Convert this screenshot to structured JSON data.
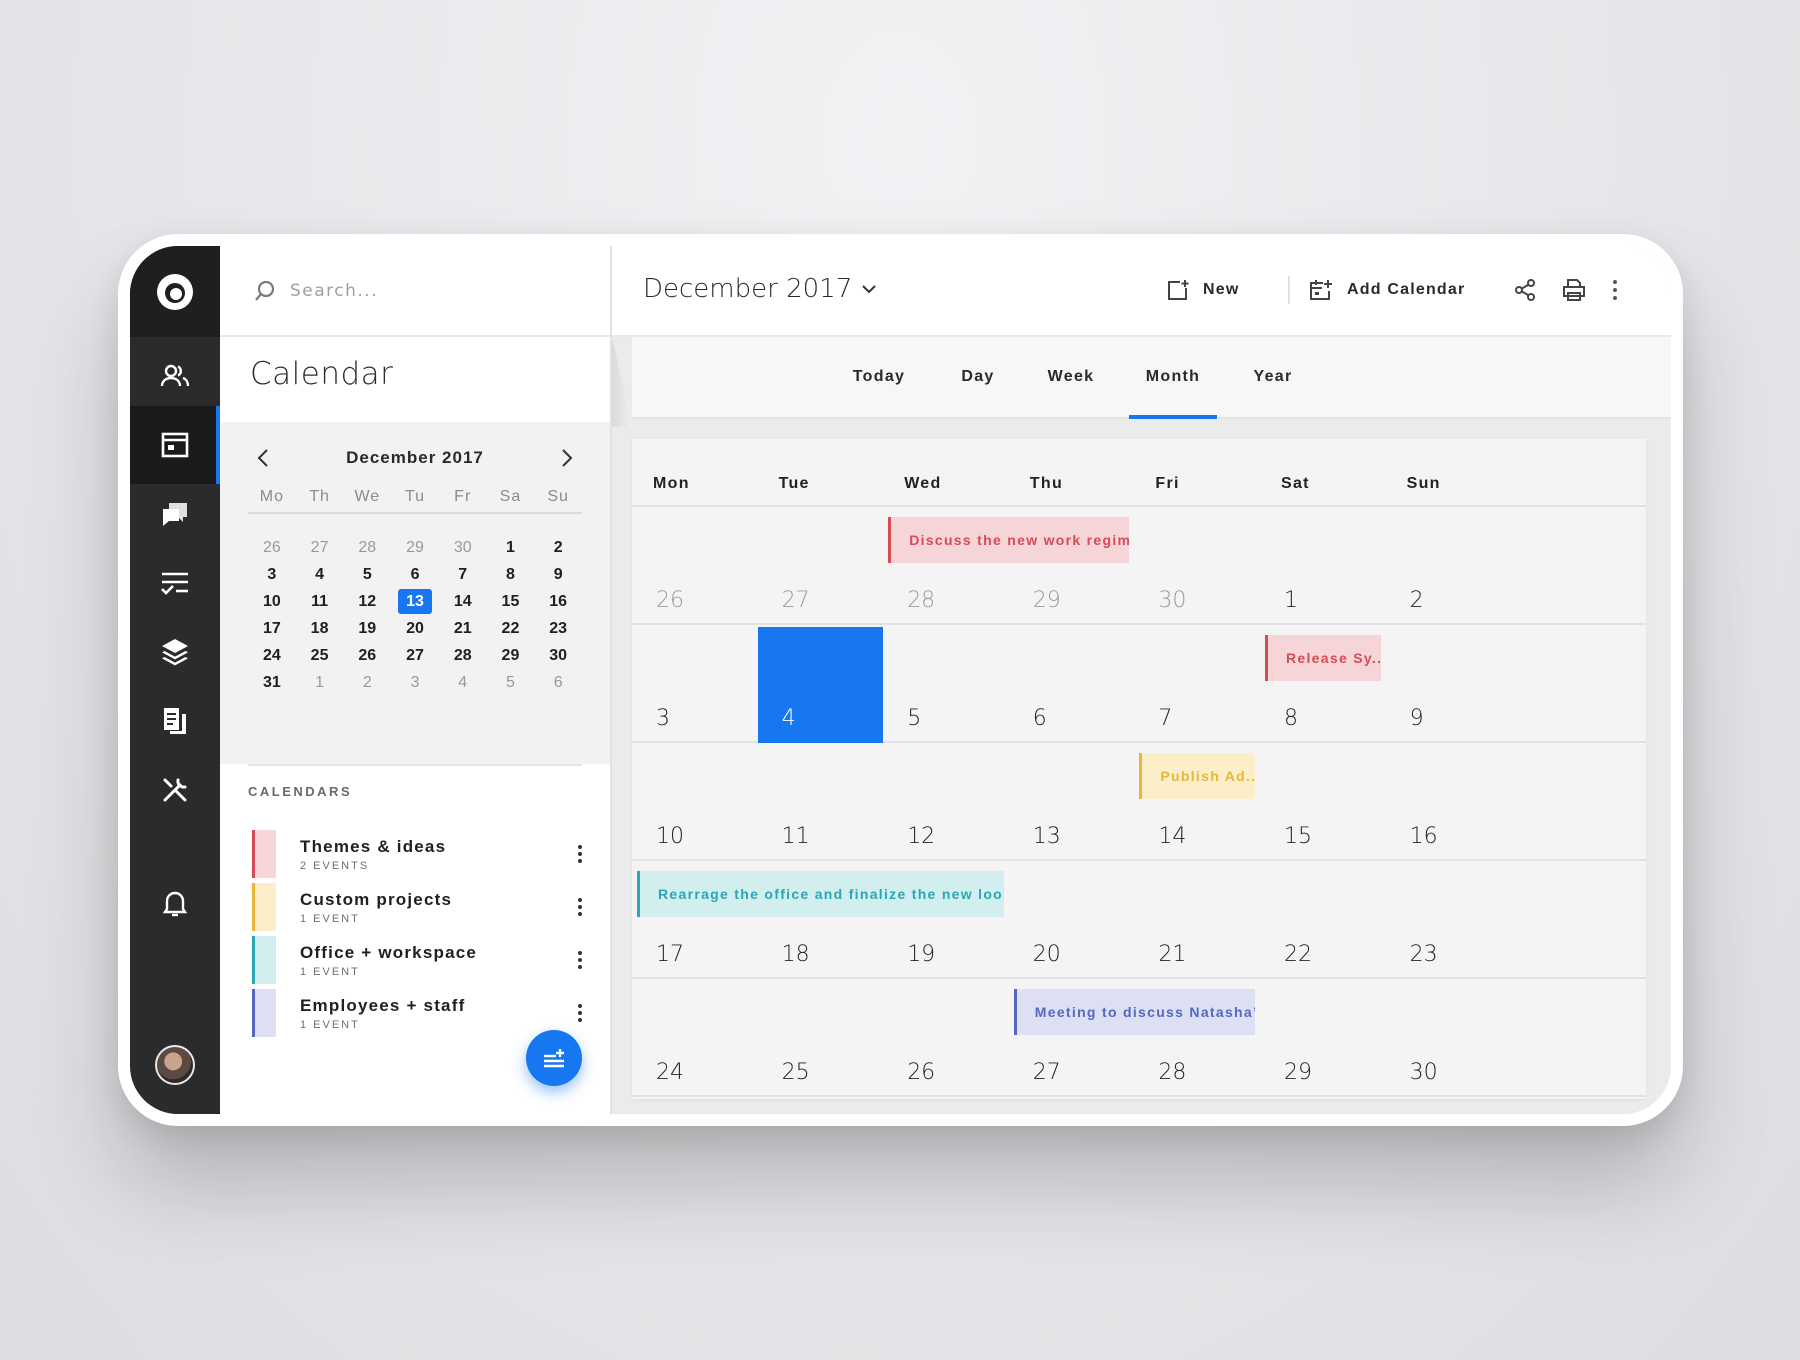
{
  "search": {
    "placeholder": "Search..."
  },
  "page_title": "Calendar",
  "mini_calendar": {
    "month_label": "December 2017",
    "weekdays": [
      "Mo",
      "Th",
      "We",
      "Tu",
      "Fr",
      "Sa",
      "Su"
    ],
    "weeks": [
      [
        {
          "d": "26",
          "muted": true
        },
        {
          "d": "27",
          "muted": true
        },
        {
          "d": "28",
          "muted": true
        },
        {
          "d": "29",
          "muted": true
        },
        {
          "d": "30",
          "muted": true
        },
        {
          "d": "1"
        },
        {
          "d": "2"
        }
      ],
      [
        {
          "d": "3"
        },
        {
          "d": "4"
        },
        {
          "d": "5"
        },
        {
          "d": "6"
        },
        {
          "d": "7"
        },
        {
          "d": "8"
        },
        {
          "d": "9"
        }
      ],
      [
        {
          "d": "10"
        },
        {
          "d": "11"
        },
        {
          "d": "12"
        },
        {
          "d": "13",
          "today": true
        },
        {
          "d": "14"
        },
        {
          "d": "15"
        },
        {
          "d": "16"
        }
      ],
      [
        {
          "d": "17"
        },
        {
          "d": "18"
        },
        {
          "d": "19"
        },
        {
          "d": "20"
        },
        {
          "d": "21"
        },
        {
          "d": "22"
        },
        {
          "d": "23"
        }
      ],
      [
        {
          "d": "24"
        },
        {
          "d": "25"
        },
        {
          "d": "26"
        },
        {
          "d": "27"
        },
        {
          "d": "28"
        },
        {
          "d": "29"
        },
        {
          "d": "30"
        }
      ],
      [
        {
          "d": "31"
        },
        {
          "d": "1",
          "muted": true
        },
        {
          "d": "2",
          "muted": true
        },
        {
          "d": "3",
          "muted": true
        },
        {
          "d": "4",
          "muted": true
        },
        {
          "d": "5",
          "muted": true
        },
        {
          "d": "6",
          "muted": true
        }
      ]
    ]
  },
  "calendars": {
    "heading": "CALENDARS",
    "items": [
      {
        "name": "Themes & ideas",
        "count": "2 EVENTS",
        "color": "#d94a55",
        "fill": "#f6d5d8"
      },
      {
        "name": "Custom projects",
        "count": "1 EVENT",
        "color": "#e8b73a",
        "fill": "#fbeec8"
      },
      {
        "name": "Office + workspace",
        "count": "1 EVENT",
        "color": "#2aa7b4",
        "fill": "#d3eeef"
      },
      {
        "name": "Employees + staff",
        "count": "1 EVENT",
        "color": "#5667c2",
        "fill": "#dde0f3"
      }
    ]
  },
  "toolbar": {
    "month_label": "December 2017",
    "new_label": "New",
    "add_calendar_label": "Add Calendar"
  },
  "view_tabs": [
    {
      "label": "Today"
    },
    {
      "label": "Day"
    },
    {
      "label": "Week"
    },
    {
      "label": "Month",
      "active": true
    },
    {
      "label": "Year"
    }
  ],
  "month_grid": {
    "weekdays": [
      "Mon",
      "Tue",
      "Wed",
      "Thu",
      "Fri",
      "Sat",
      "Sun"
    ],
    "weeks": [
      {
        "days": [
          {
            "d": "26",
            "muted": true
          },
          {
            "d": "27",
            "muted": true
          },
          {
            "d": "28",
            "muted": true
          },
          {
            "d": "29",
            "muted": true
          },
          {
            "d": "30",
            "muted": true
          },
          {
            "d": "1"
          },
          {
            "d": "2"
          }
        ],
        "events": [
          {
            "title": "Discuss the new work regim...",
            "start": 2,
            "span": 2,
            "calendar": 0
          }
        ]
      },
      {
        "days": [
          {
            "d": "3"
          },
          {
            "d": "4",
            "selected": true
          },
          {
            "d": "5"
          },
          {
            "d": "6"
          },
          {
            "d": "7"
          },
          {
            "d": "8"
          },
          {
            "d": "9"
          }
        ],
        "events": [
          {
            "title": "Release Sy...",
            "start": 5,
            "span": 1,
            "calendar": 0
          }
        ]
      },
      {
        "days": [
          {
            "d": "10"
          },
          {
            "d": "11"
          },
          {
            "d": "12"
          },
          {
            "d": "13"
          },
          {
            "d": "14"
          },
          {
            "d": "15"
          },
          {
            "d": "16"
          }
        ],
        "events": [
          {
            "title": "Publish Ad...",
            "start": 4,
            "span": 1,
            "calendar": 1
          }
        ]
      },
      {
        "days": [
          {
            "d": "17"
          },
          {
            "d": "18"
          },
          {
            "d": "19"
          },
          {
            "d": "20"
          },
          {
            "d": "21"
          },
          {
            "d": "22"
          },
          {
            "d": "23"
          }
        ],
        "events": [
          {
            "title": "Rearrage the office and finalize the new look",
            "start": 0,
            "span": 3,
            "calendar": 2
          }
        ]
      },
      {
        "days": [
          {
            "d": "24"
          },
          {
            "d": "25"
          },
          {
            "d": "26"
          },
          {
            "d": "27"
          },
          {
            "d": "28"
          },
          {
            "d": "29"
          },
          {
            "d": "30"
          }
        ],
        "events": [
          {
            "title": "Meeting to discuss Natasha’s...",
            "start": 3,
            "span": 2,
            "calendar": 3
          }
        ]
      }
    ]
  },
  "colors": {
    "accent": "#1677f0",
    "rail": "#2b2b2d"
  }
}
